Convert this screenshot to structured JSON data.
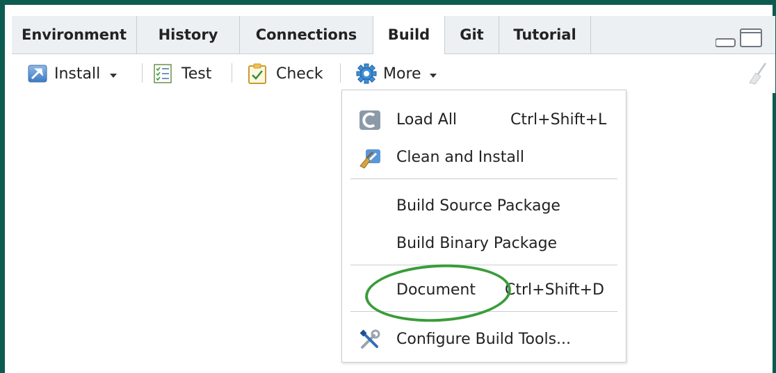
{
  "tabs": [
    {
      "label": "Environment",
      "active": false
    },
    {
      "label": "History",
      "active": false
    },
    {
      "label": "Connections",
      "active": false
    },
    {
      "label": "Build",
      "active": true
    },
    {
      "label": "Git",
      "active": false
    },
    {
      "label": "Tutorial",
      "active": false
    }
  ],
  "toolbar": {
    "install_label": "Install",
    "test_label": "Test",
    "check_label": "Check",
    "more_label": "More"
  },
  "menu": {
    "items": [
      {
        "label": "Load All",
        "shortcut": "Ctrl+Shift+L",
        "icon": "load-all-icon"
      },
      {
        "label": "Clean and Install",
        "shortcut": "",
        "icon": "clean-install-icon"
      },
      {
        "label": "Build Source Package",
        "shortcut": "",
        "icon": ""
      },
      {
        "label": "Build Binary Package",
        "shortcut": "",
        "icon": ""
      },
      {
        "label": "Document",
        "shortcut": "Ctrl+Shift+D",
        "icon": ""
      },
      {
        "label": "Configure Build Tools...",
        "shortcut": "",
        "icon": "configure-tools-icon"
      }
    ]
  },
  "colors": {
    "frame": "#0b5b51",
    "tabbar": "#ecf0f3",
    "highlight_circle": "#3a9c3a"
  }
}
